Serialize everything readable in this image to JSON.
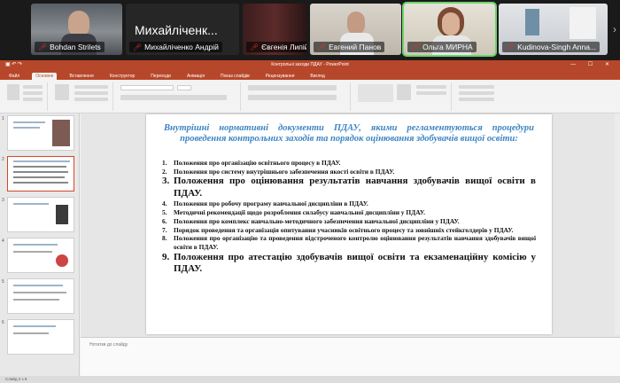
{
  "participants": [
    {
      "name": "Bohdan Strilets",
      "mic": "muted"
    },
    {
      "name": "Михайліченко Андрій",
      "mic": "muted",
      "display_name": "Михайліченк..."
    },
    {
      "name": "Євгенія Липій",
      "mic": "muted"
    },
    {
      "name": "Евгений Панов",
      "mic": "muted"
    },
    {
      "name": "Ольга МИРНА",
      "mic": "muted",
      "active": true
    },
    {
      "name": "Kudinova-Singh Anna...",
      "mic": "muted"
    }
  ],
  "ppt": {
    "title": "Контрольні заходи ПДАУ - PowerPoint",
    "tabs": [
      "Файл",
      "Основне",
      "Вставлення",
      "Конструктор",
      "Переходи",
      "Анімація",
      "Показ слайдів",
      "Рецензування",
      "Вигляд"
    ],
    "notes_placeholder": "Нотатки до слайду",
    "status": "Слайд 2 з 9"
  },
  "slide": {
    "heading": "Внутрішні нормативні документи ПДАУ, якими регламентуються процедури проведення контрольних заходів та порядок оцінювання здобувачів вищої освіти:",
    "items": [
      {
        "n": "1.",
        "text": "Положення про організацію освітнього процесу в ПДАУ.",
        "size": "small"
      },
      {
        "n": "2.",
        "text": "Положення про систему внутрішнього забезпечення якості освіти в ПДАУ.",
        "size": "small"
      },
      {
        "n": "3.",
        "text": "Положення про оцінювання результатів навчання здобувачів вищої освіти в ПДАУ.",
        "size": "big"
      },
      {
        "n": "4.",
        "text": "Положення про робочу програму навчальної дисципліни в ПДАУ.",
        "size": "small"
      },
      {
        "n": "5.",
        "text": "Методичні рекомендації щодо розроблення силабусу навчальної дисципліни у ПДАУ.",
        "size": "small"
      },
      {
        "n": "6.",
        "text": "Положення про комплекс навчально-методичного забезпечення навчальної дисципліни у ПДАУ.",
        "size": "small"
      },
      {
        "n": "7.",
        "text": "Порядок проведення та організація опитування учасників освітнього процесу та зовнішніх стейкголдерів у ПДАУ.",
        "size": "small"
      },
      {
        "n": "8.",
        "text": "Положення про організацію та проведення відстроченого контролю оцінювання результатів навчання здобувачів вищої освіти в ПДАУ.",
        "size": "small"
      },
      {
        "n": "9.",
        "text": "Положення про атестацію здобувачів вищої освіти та екзаменаційну комісію у ПДАУ.",
        "size": "big"
      }
    ]
  },
  "thumbnails": [
    "1",
    "2",
    "3",
    "4",
    "5",
    "6"
  ]
}
